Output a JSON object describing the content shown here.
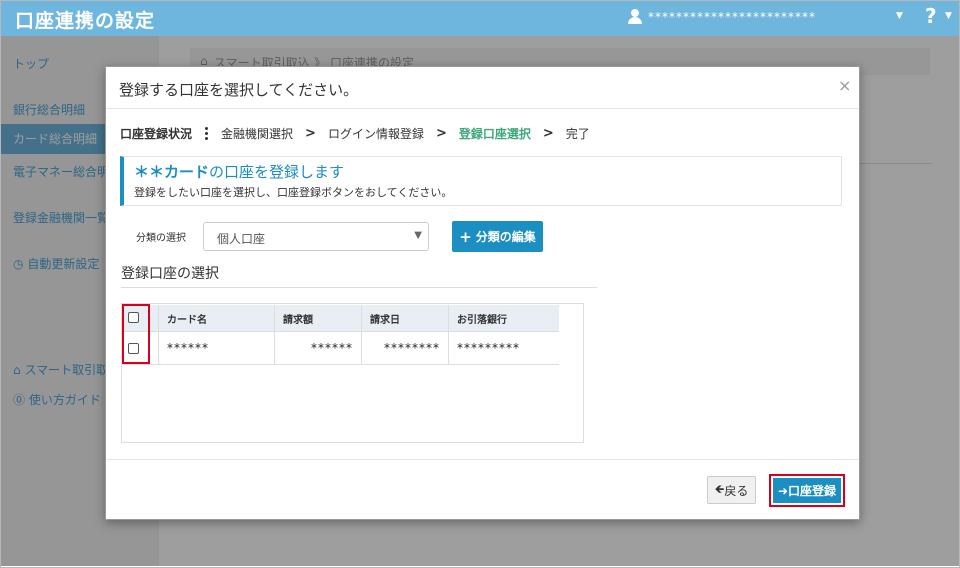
{
  "header": {
    "title": "口座連携の設定",
    "user_name": "************************",
    "help_label": "?"
  },
  "sidebar": {
    "items": [
      {
        "label": "トップ"
      },
      {
        "label": "銀行総合明細"
      },
      {
        "label": "カード総合明細"
      },
      {
        "label": "電子マネー総合明細"
      },
      {
        "label": "登録金融機関一覧"
      },
      {
        "label": "自動更新設定"
      },
      {
        "label": "スマート取引取込"
      },
      {
        "label": "使い方ガイド・"
      }
    ]
  },
  "breadcrumb": {
    "home": "スマート取引取込",
    "separator": "》",
    "current": "口座連携の設定"
  },
  "modal": {
    "title": "登録する口座を選択してください。",
    "close": "×",
    "steps": {
      "status_label": "口座登録状況",
      "items": [
        "金融機関選択",
        "ログイン情報登録",
        "登録口座選択",
        "完了"
      ],
      "arrow": ">"
    },
    "info": {
      "title_prefix": "＊＊カード",
      "title_suffix": "の口座を登録します",
      "description": "登録をしたい口座を選択し、口座登録ボタンをおしてください。"
    },
    "category": {
      "label": "分類の選択",
      "value": "個人口座",
      "edit_button": "分類の編集"
    },
    "section_title": "登録口座の選択",
    "table": {
      "headers": [
        "カード名",
        "請求額",
        "請求日",
        "お引落銀行"
      ],
      "rows": [
        [
          "******",
          "******",
          "********",
          "*********"
        ]
      ]
    },
    "back_button": "戻る",
    "register_button": "口座登録"
  },
  "colors": {
    "header_bg": "#6fb6de",
    "accent": "#1b8ec2",
    "current_step": "#3da97a",
    "highlight": "#d6001c"
  }
}
